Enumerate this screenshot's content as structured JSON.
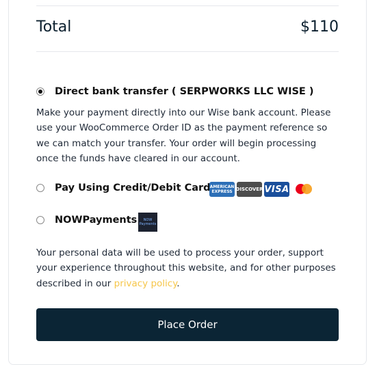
{
  "order_summary": {
    "total_label": "Total",
    "total_value": "$110"
  },
  "payment_methods": {
    "selected": "bank_transfer",
    "bank_transfer": {
      "label": "Direct bank transfer ( SERPWORKS LLC WISE )",
      "description": "Make your payment directly into our Wise bank account. Please use your WooCommerce Order ID as the payment reference so we can match your transfer. Your order will begin processing once the funds have cleared in our account."
    },
    "cards": {
      "label": "Pay Using Credit/Debit Cards",
      "brands": {
        "amex": "AMERICAN EXPRESS",
        "discover": "DISCOVER",
        "visa": "VISA",
        "mastercard_icon": "mastercard-icon"
      }
    },
    "nowpayments": {
      "label": "NOWPayments",
      "logo_text": "NOW Payments"
    }
  },
  "privacy": {
    "text_before": "Your personal data will be used to process your order, support your experience throughout this website, and for other purposes described in our ",
    "link_text": "privacy policy",
    "text_after": "."
  },
  "actions": {
    "place_order_label": "Place Order"
  },
  "colors": {
    "button_bg": "#0b2535",
    "link": "#f6c64a",
    "divider": "#e5e7eb"
  }
}
